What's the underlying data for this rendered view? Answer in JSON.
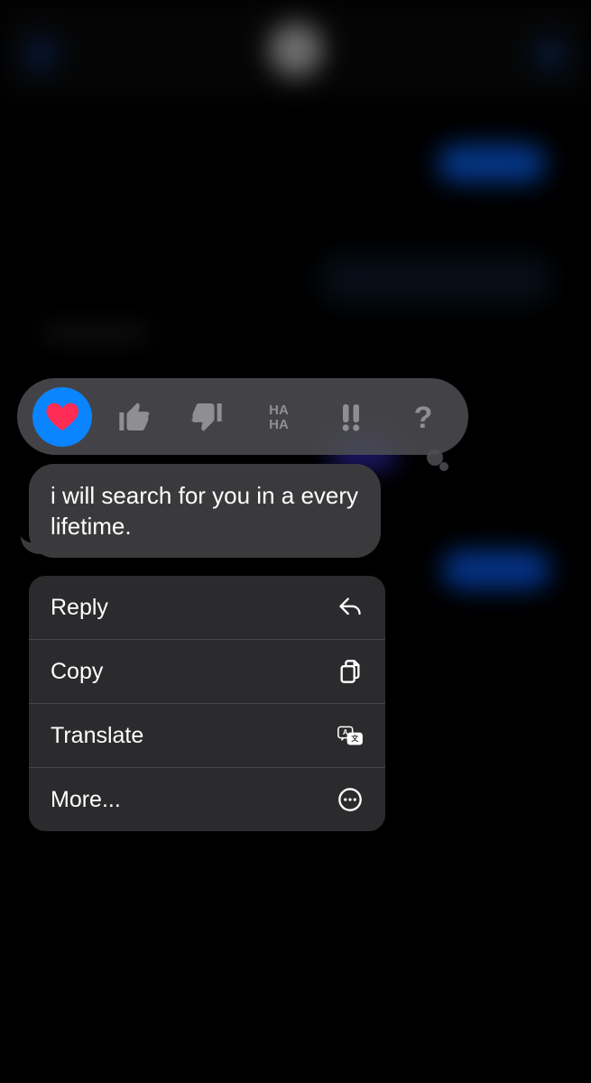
{
  "colors": {
    "accent": "#0a84ff",
    "heart": "#ff2d55",
    "bubble_incoming": "#3a3a3c",
    "bubble_outgoing": "#0a67ff",
    "menu_bg": "rgba(44,44,46,0.97)",
    "tapback_bg": "rgba(79,79,83,0.85)",
    "inactive_icon": "#8e8e93"
  },
  "message": {
    "text": "i will search for you in a every lifetime."
  },
  "tapbacks": {
    "items": [
      {
        "name": "heart",
        "selected": true
      },
      {
        "name": "thumbs-up",
        "selected": false
      },
      {
        "name": "thumbs-down",
        "selected": false
      },
      {
        "name": "haha",
        "selected": false
      },
      {
        "name": "exclaim",
        "selected": false
      },
      {
        "name": "question",
        "selected": false
      }
    ]
  },
  "context_menu": {
    "items": [
      {
        "label": "Reply",
        "icon": "reply-arrow"
      },
      {
        "label": "Copy",
        "icon": "copy-docs"
      },
      {
        "label": "Translate",
        "icon": "translate"
      },
      {
        "label": "More...",
        "icon": "ellipsis-circle"
      }
    ]
  }
}
